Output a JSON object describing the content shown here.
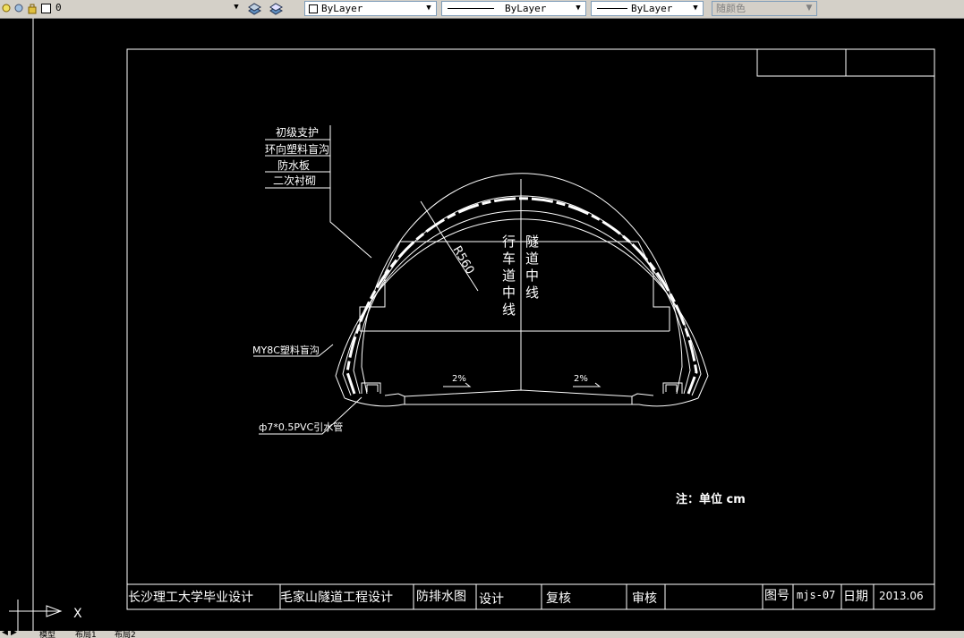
{
  "toolbar": {
    "layer_name": "0",
    "color": "ByLayer",
    "linetype": "ByLayer",
    "lineweight": "ByLayer",
    "plot_style": "随颜色"
  },
  "drawing": {
    "labels": {
      "primary_support": "初级支护",
      "ring_drain": "环向塑料盲沟",
      "waterproof_board": "防水板",
      "secondary_lining": "二次衬砌",
      "radius": "R560",
      "lane_center": "行车道中线",
      "tunnel_center": "隧道中线",
      "slope_left": "2%",
      "slope_right": "2%",
      "my8c_drain": "MY8C塑料盲沟",
      "pvc_pipe": "ф7*0.5PVC引水管",
      "note": "注：单位 cm"
    },
    "title_block": {
      "school": "长沙理工大学毕业设计",
      "project": "毛家山隧道工程设计",
      "drawing_name": "防排水图",
      "design": "设计",
      "review": "复核",
      "audit": "审核",
      "drawing_no_label": "图号",
      "drawing_no": "mjs-07",
      "date_label": "日期",
      "date": "2013.06"
    }
  },
  "ucs": {
    "x": "X"
  },
  "tabs": {
    "model": "模型",
    "layout1": "布局1",
    "layout2": "布局2"
  }
}
